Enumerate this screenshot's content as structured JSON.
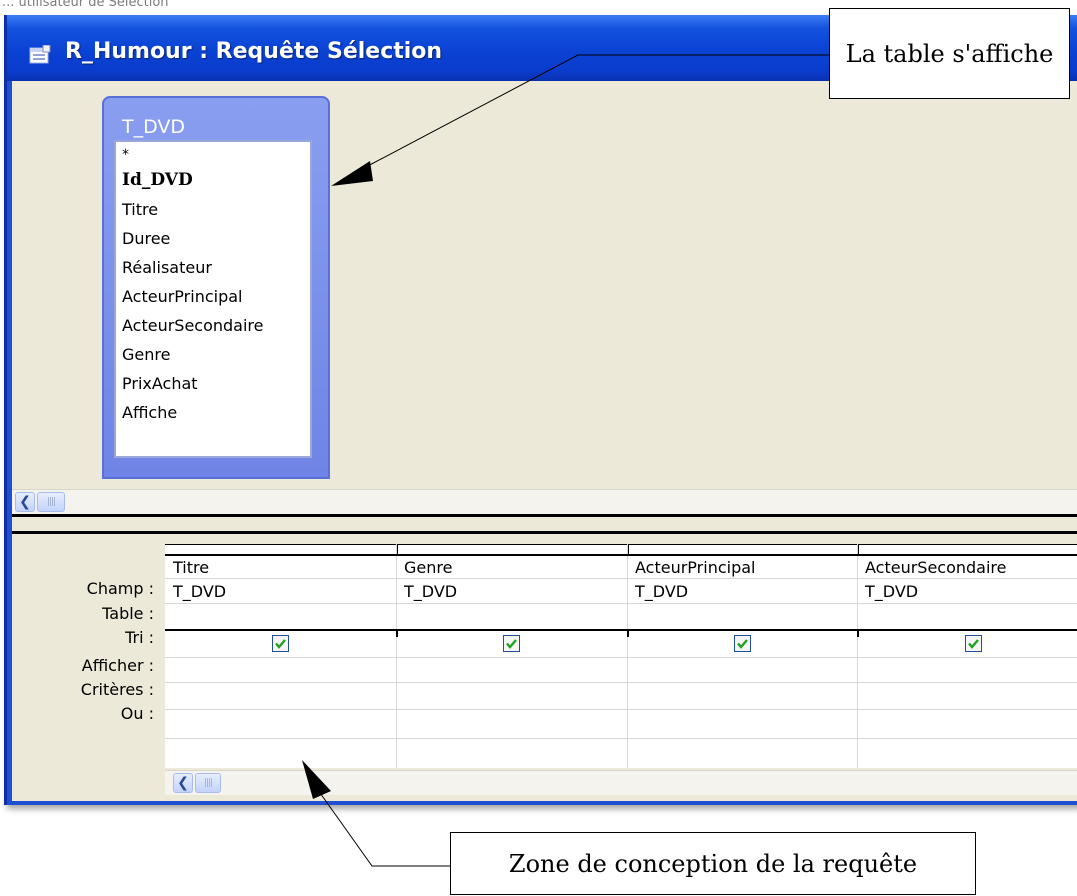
{
  "background_fragment": "...  utilisateur de Sélection",
  "window": {
    "title": "R_Humour : Requête Sélection",
    "title_icon": "query-icon"
  },
  "design_pane": {
    "table": {
      "name": "T_DVD",
      "star": "*",
      "primary_key": "Id_DVD",
      "fields": [
        "Titre",
        "Duree",
        "Réalisateur",
        "ActeurPrincipal",
        "ActeurSecondaire",
        "Genre",
        "PrixAchat",
        "Affiche"
      ]
    },
    "scroll_left_icon": "chevron-left-icon",
    "scroll_thumb_icon": "grip-icon"
  },
  "grid": {
    "row_labels": [
      "Champ :",
      "Table :",
      "Tri :",
      "Afficher :",
      "Critères :",
      "Ou :"
    ],
    "columns": [
      {
        "champ": "Titre",
        "table": "T_DVD",
        "tri": "",
        "afficher": true
      },
      {
        "champ": "Genre",
        "table": "T_DVD",
        "tri": "",
        "afficher": true
      },
      {
        "champ": "ActeurPrincipal",
        "table": "T_DVD",
        "tri": "",
        "afficher": true
      },
      {
        "champ": "ActeurSecondaire",
        "table": "T_DVD",
        "tri": "",
        "afficher": true
      }
    ]
  },
  "annotations": {
    "top": "La table s'affiche",
    "bottom": "Zone de conception de la requête"
  },
  "colors": {
    "titlebar": "#0a42d4",
    "pane_background": "#ece9d8",
    "table_header": "#7b8fe8",
    "checkbox_check": "#21a121"
  }
}
